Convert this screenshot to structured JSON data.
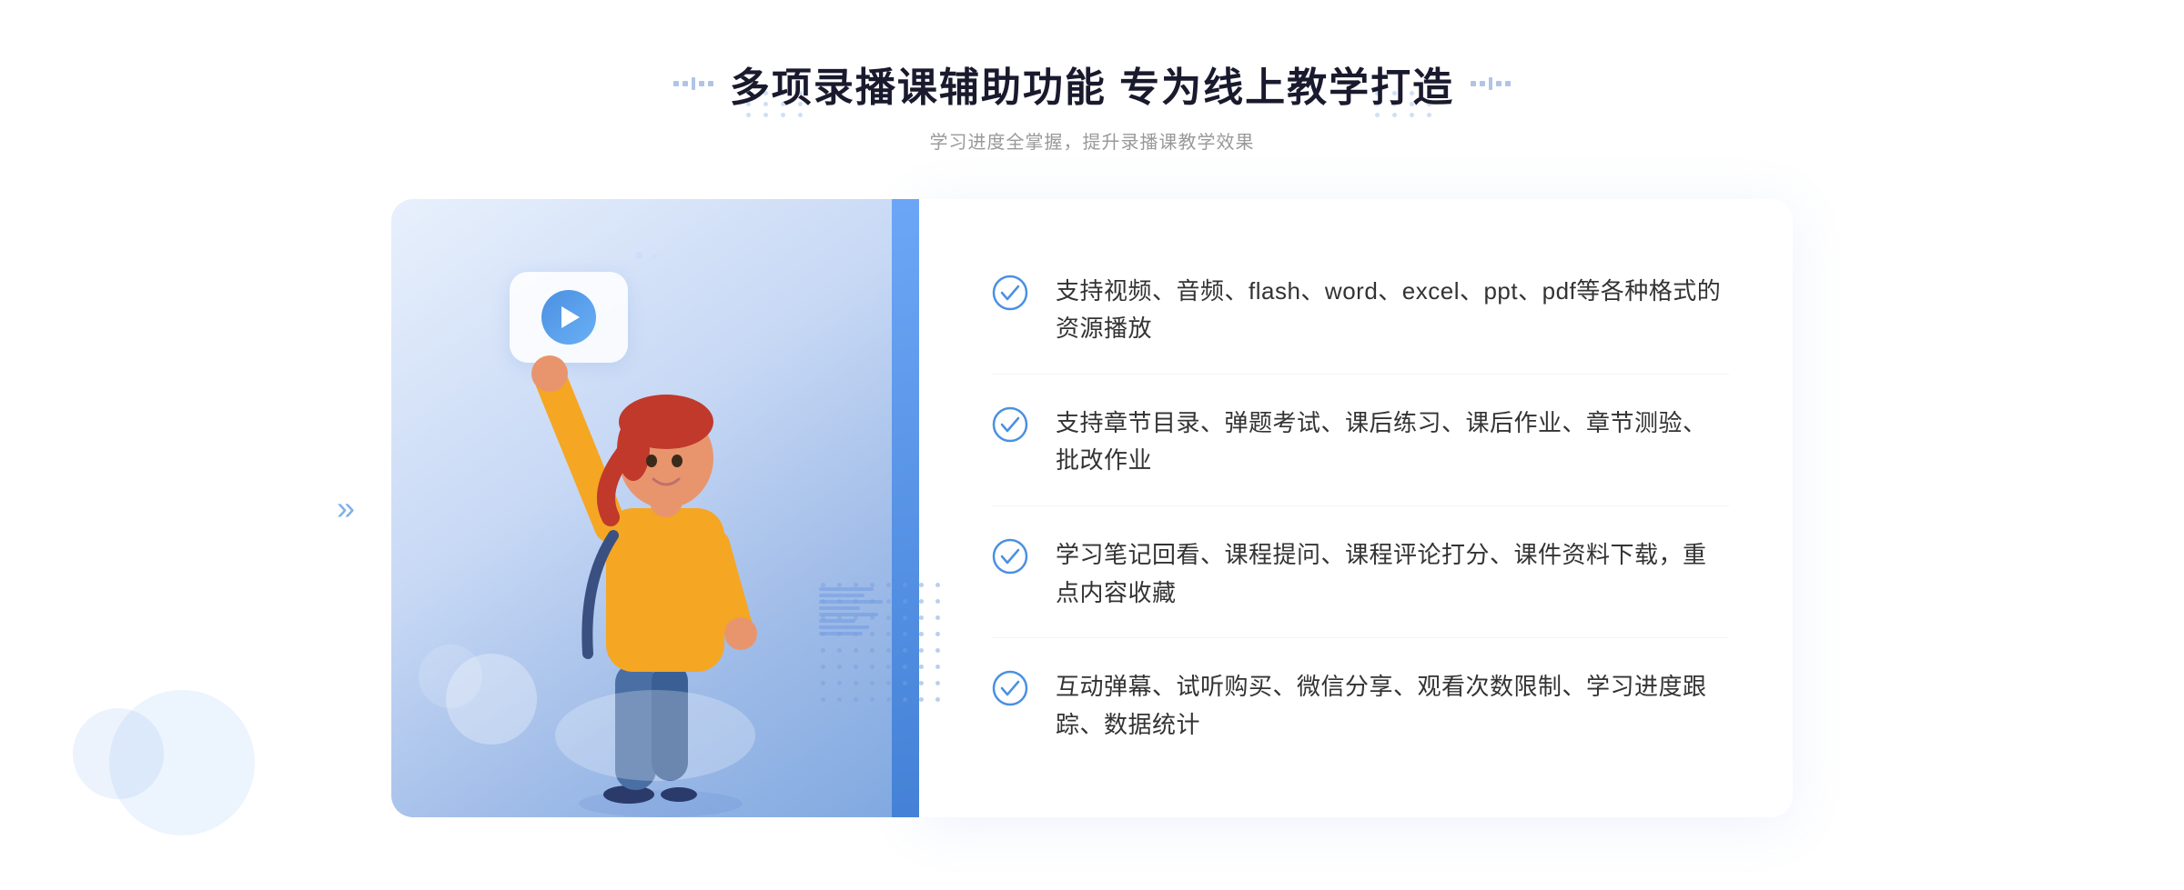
{
  "header": {
    "title": "多项录播课辅助功能 专为线上教学打造",
    "subtitle": "学习进度全掌握，提升录播课教学效果",
    "decorator_left": "❖",
    "decorator_right": "❖"
  },
  "features": [
    {
      "id": "feature-1",
      "text": "支持视频、音频、flash、word、excel、ppt、pdf等各种格式的资源播放"
    },
    {
      "id": "feature-2",
      "text": "支持章节目录、弹题考试、课后练习、课后作业、章节测验、批改作业"
    },
    {
      "id": "feature-3",
      "text": "学习笔记回看、课程提问、课程评论打分、课件资料下载，重点内容收藏"
    },
    {
      "id": "feature-4",
      "text": "互动弹幕、试听购买、微信分享、观看次数限制、学习进度跟踪、数据统计"
    }
  ],
  "chevron": "«",
  "accent_color": "#4a90e2",
  "accent_color_light": "#e8f2ff"
}
